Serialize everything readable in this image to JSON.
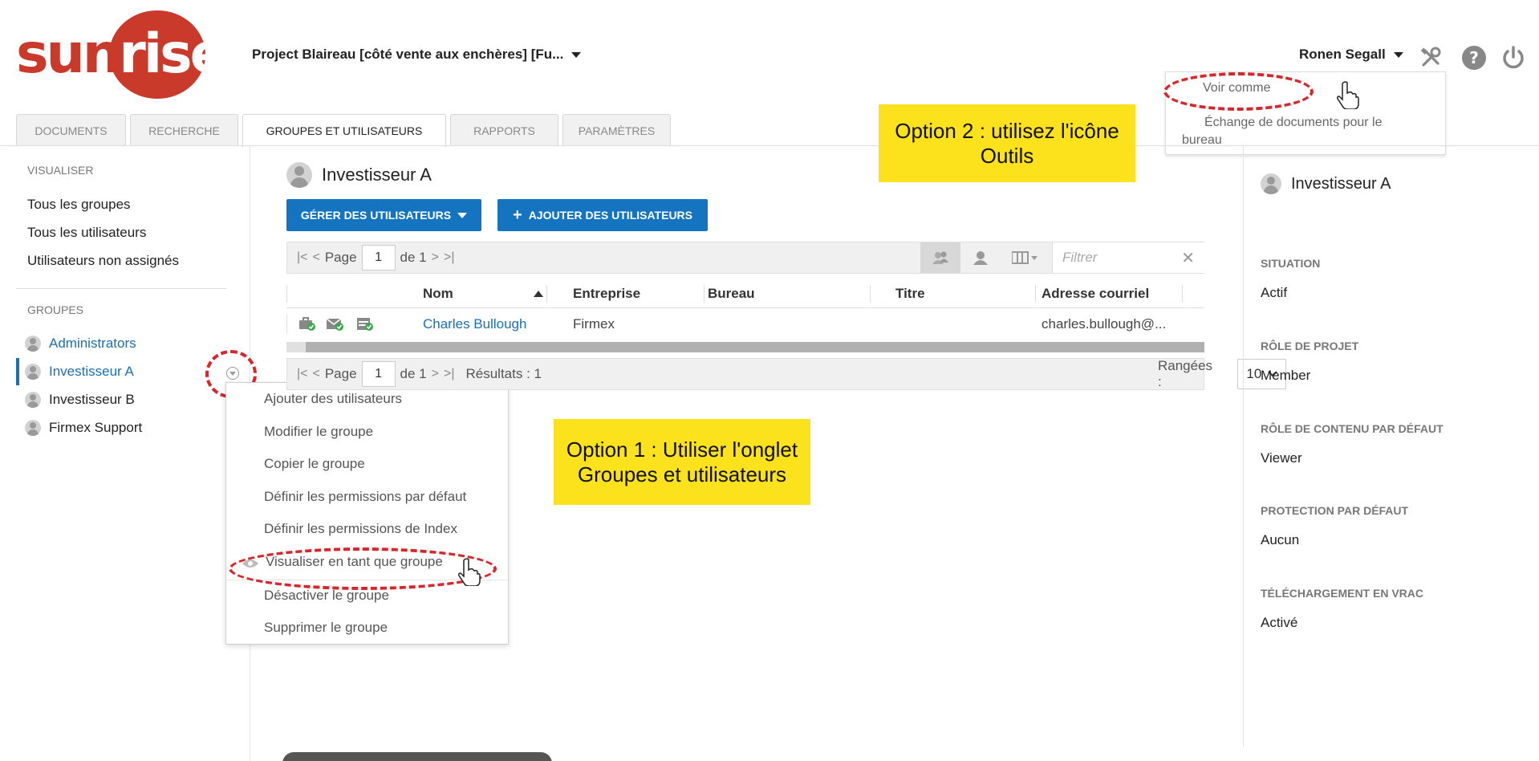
{
  "header": {
    "logo_text_1": "sun",
    "logo_text_2": "rise",
    "project_name": "Project Blaireau [côté vente aux enchères] [Fu...",
    "user_name": "Ronen Segall",
    "icons": [
      "tools-icon",
      "help-icon",
      "power-icon"
    ]
  },
  "user_menu": {
    "items": [
      "Voir comme",
      "Échange de documents pour le",
      "bureau"
    ]
  },
  "tabs": [
    {
      "label": "DOCUMENTS",
      "active": false
    },
    {
      "label": "RECHERCHE",
      "active": false
    },
    {
      "label": "GROUPES ET UTILISATEURS",
      "active": true
    },
    {
      "label": "RAPPORTS",
      "active": false
    },
    {
      "label": "PARAMÈTRES",
      "active": false
    }
  ],
  "annotations": {
    "option2": [
      "Option 2 : utilisez l'icône",
      "Outils"
    ],
    "option1": [
      "Option 1 : Utiliser l'onglet",
      "Groupes et utilisateurs"
    ]
  },
  "sidebar": {
    "view_heading": "VISUALISER",
    "view_items": [
      "Tous les groupes",
      "Tous les utilisateurs",
      "Utilisateurs non assignés"
    ],
    "groups_heading": "GROUPES",
    "groups": [
      {
        "name": "Administrators",
        "link": true
      },
      {
        "name": "Investisseur A",
        "link": true,
        "selected": true
      },
      {
        "name": "Investisseur B",
        "link": false
      },
      {
        "name": "Firmex Support",
        "link": false
      }
    ]
  },
  "context_menu": {
    "items": [
      "Ajouter des utilisateurs",
      "Modifier le groupe",
      "Copier le groupe",
      "Définir les permissions par défaut",
      "Définir les permissions de Index",
      "Visualiser en tant que groupe",
      "Désactiver le groupe",
      "Supprimer le groupe"
    ]
  },
  "main": {
    "title": "Investisseur A",
    "manage_button": "GÉRER DES UTILISATEURS",
    "add_button": "AJOUTER DES UTILISATEURS",
    "pager": {
      "page_label": "Page",
      "page": "1",
      "of_label": "de 1",
      "results": "Résultats : 1",
      "rows_label": "Rangées :",
      "rows_value": "10"
    },
    "filter_placeholder": "Filtrer",
    "columns": [
      "Nom",
      "Entreprise",
      "Bureau",
      "Titre",
      "Adresse courriel"
    ],
    "rows": [
      {
        "nom": "Charles Bullough",
        "entreprise": "Firmex",
        "bureau": "",
        "titre": "",
        "email": "charles.bullough@..."
      }
    ]
  },
  "right_panel": {
    "title": "Investisseur A",
    "fields": [
      {
        "label": "SITUATION",
        "value": "Actif"
      },
      {
        "label": "RÔLE DE PROJET",
        "value": "Member"
      },
      {
        "label": "RÔLE DE CONTENU PAR DÉFAUT",
        "value": "Viewer"
      },
      {
        "label": "PROTECTION PAR DÉFAUT",
        "value": "Aucun"
      },
      {
        "label": "TÉLÉCHARGEMENT EN VRAC",
        "value": "Activé"
      }
    ]
  },
  "colors": {
    "accent": "#1574c0",
    "brand": "#c93a2a",
    "highlight": "#fbe21c",
    "annotation_ring": "#d8262b"
  }
}
